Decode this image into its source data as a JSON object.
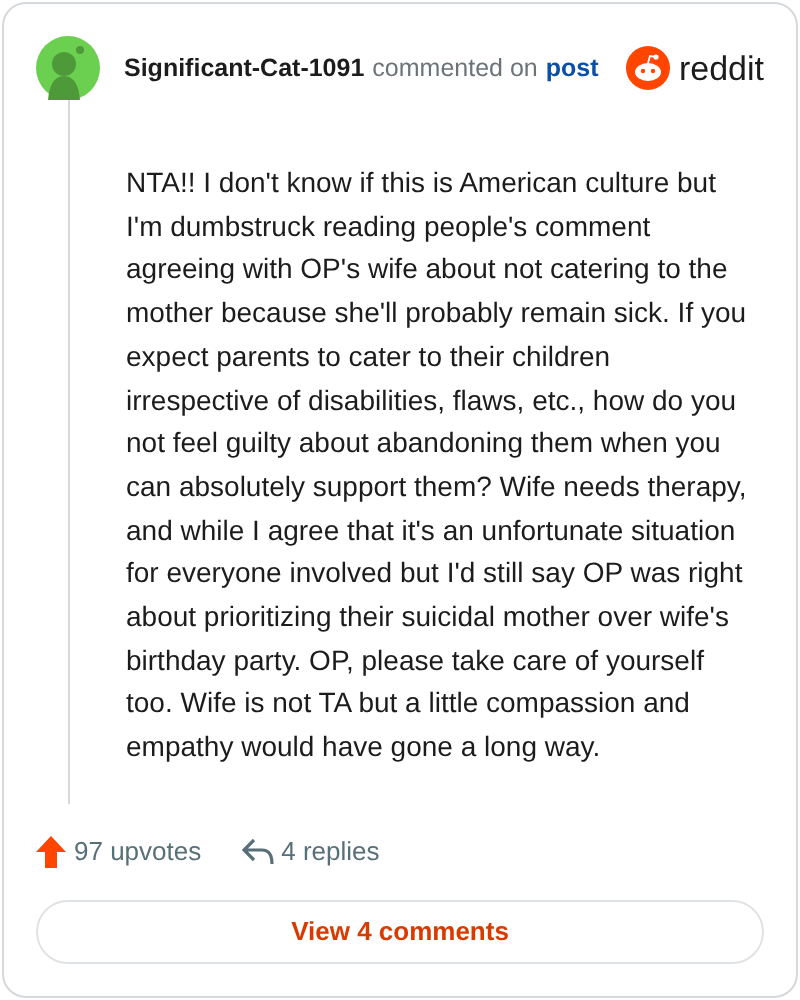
{
  "comment": {
    "author": "Significant-Cat-1091",
    "action": "commented on",
    "link": "post",
    "brand": "reddit",
    "body": "NTA!! I don't know if this is American culture but I'm dumbstruck reading people's comment agreeing with OP's wife about not catering to the mother because she'll probably remain sick. If you expect parents to cater to their children irrespective of disabilities, flaws, etc., how do you not feel guilty about abandoning them when you can absolutely support them? Wife needs therapy, and while I agree that it's an unfortunate situation for everyone involved but I'd still say OP was right about prioritizing their suicidal mother over wife's birthday party. OP, please take care of yourself too. Wife is not TA but a little compassion and empathy would have gone a long way.",
    "upvotes": "97 upvotes",
    "replies": "4 replies"
  },
  "button": "View 4 comments"
}
